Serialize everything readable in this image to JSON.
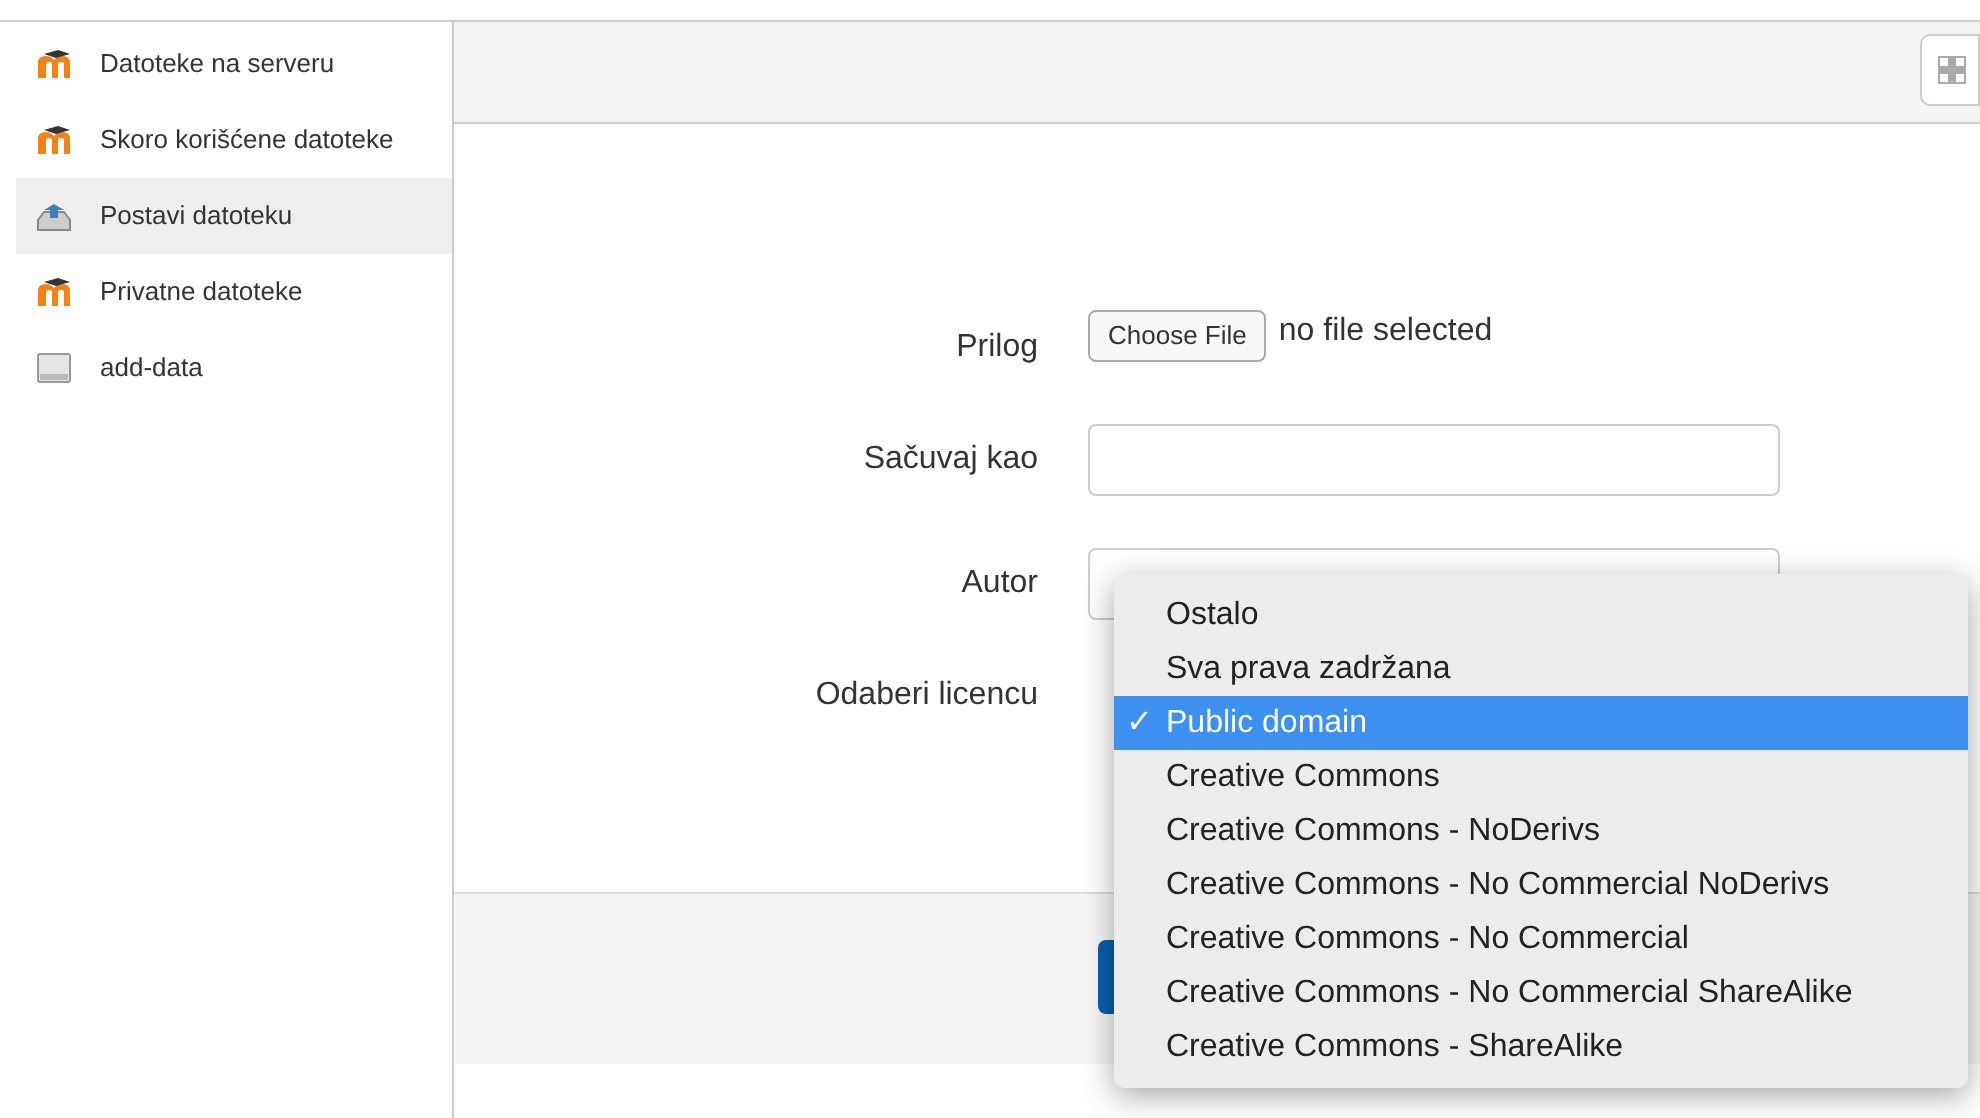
{
  "sidebar": {
    "items": [
      {
        "label": "Datoteke na serveru",
        "kind": "moodle",
        "selected": false
      },
      {
        "label": "Skoro korišćene datoteke",
        "kind": "moodle",
        "selected": false
      },
      {
        "label": "Postavi datoteku",
        "kind": "upload",
        "selected": true
      },
      {
        "label": "Privatne datoteke",
        "kind": "moodle",
        "selected": false
      },
      {
        "label": "add-data",
        "kind": "drive",
        "selected": false
      }
    ]
  },
  "form": {
    "attachment": {
      "label": "Prilog",
      "button": "Choose File",
      "status": "no file selected"
    },
    "save_as": {
      "label": "Sačuvaj kao"
    },
    "author": {
      "label": "Autor"
    },
    "license": {
      "label": "Odaberi licencu"
    }
  },
  "license_menu": {
    "options": [
      {
        "label": "Ostalo",
        "selected": false
      },
      {
        "label": "Sva prava zadržana",
        "selected": false
      },
      {
        "label": "Public domain",
        "selected": true
      },
      {
        "label": "Creative Commons",
        "selected": false
      },
      {
        "label": "Creative Commons - NoDerivs",
        "selected": false
      },
      {
        "label": "Creative Commons - No Commercial NoDerivs",
        "selected": false
      },
      {
        "label": "Creative Commons - No Commercial",
        "selected": false
      },
      {
        "label": "Creative Commons - No Commercial ShareAlike",
        "selected": false
      },
      {
        "label": "Creative Commons - ShareAlike",
        "selected": false
      }
    ],
    "check": "✓"
  }
}
